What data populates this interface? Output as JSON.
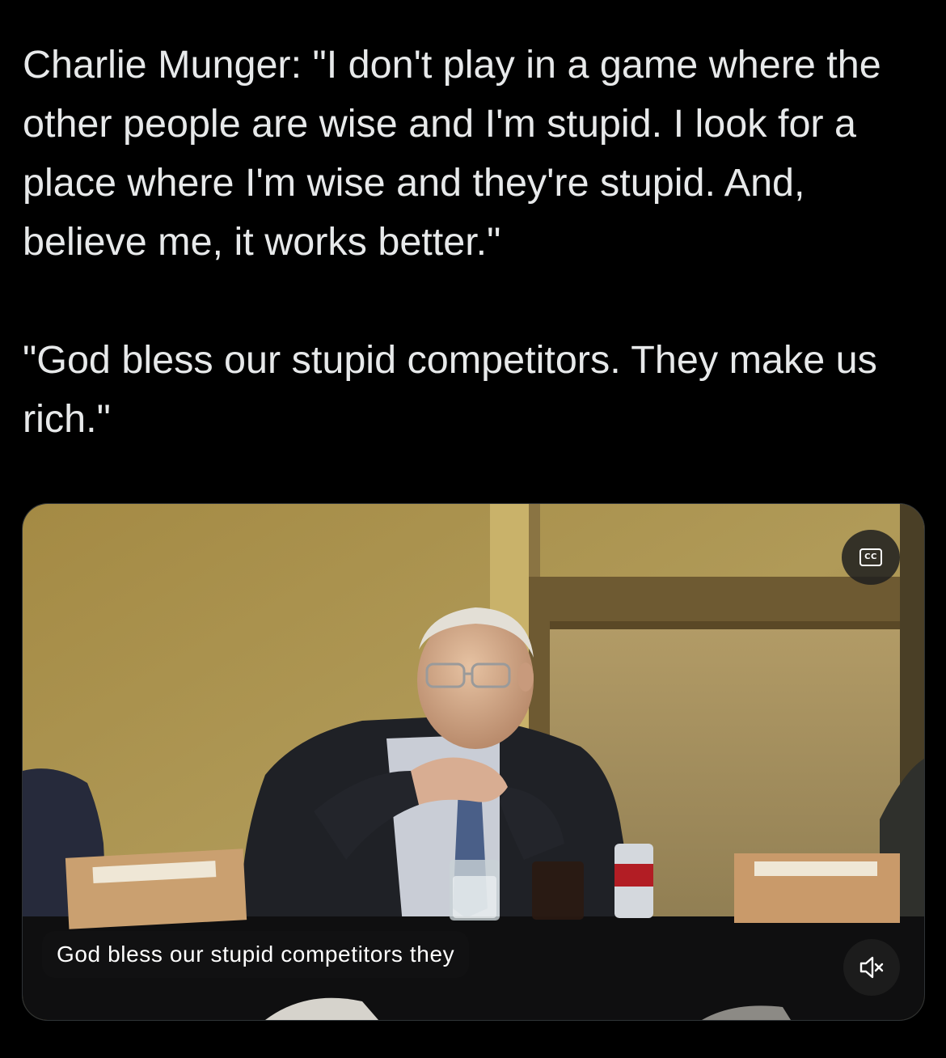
{
  "tweet": {
    "paragraphs": [
      "Charlie Munger: \"I don't play in a game where the other people are wise and I'm stupid. I look for a place where I'm wise and they're stupid. And, believe me, it works better.\"",
      "\"God bless our stupid competitors. They make us rich.\""
    ]
  },
  "video": {
    "captions_button_label": "CC",
    "caption_text": "God bless our stupid competitors they",
    "mute_icon": "speaker-muted-icon",
    "captions_icon": "closed-captions-icon"
  },
  "colors": {
    "background": "#000000",
    "text": "#e7e9ea",
    "border": "#2f3336",
    "wall": "#a8924c",
    "suit": "#1f2126"
  }
}
